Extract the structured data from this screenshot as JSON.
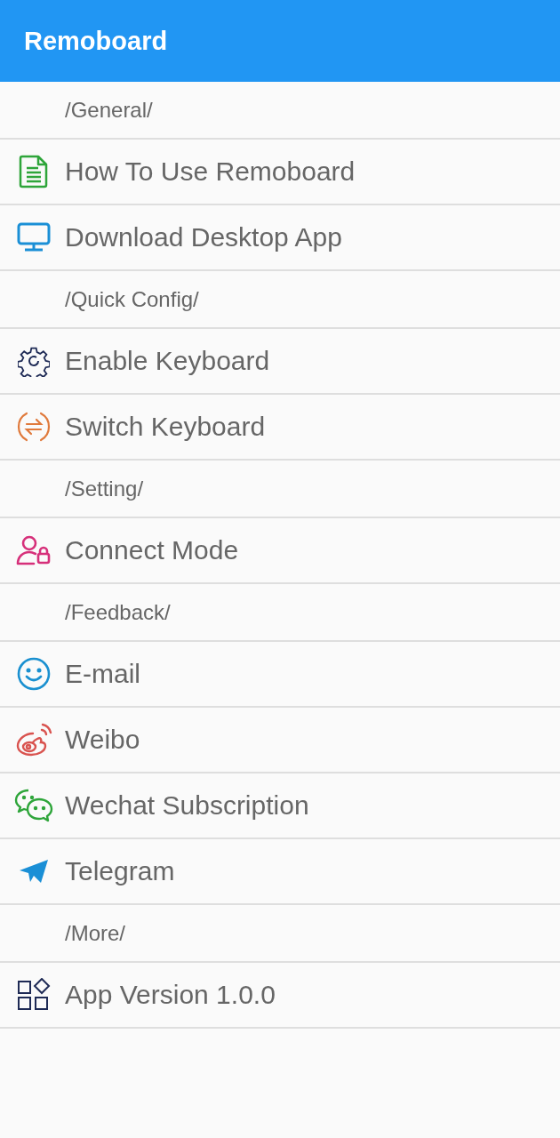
{
  "app_bar": {
    "title": "Remoboard"
  },
  "list": [
    {
      "kind": "section",
      "label": "/General/"
    },
    {
      "kind": "item",
      "label": "How To Use Remoboard"
    },
    {
      "kind": "item",
      "label": "Download Desktop App"
    },
    {
      "kind": "section",
      "label": "/Quick Config/"
    },
    {
      "kind": "item",
      "label": "Enable Keyboard"
    },
    {
      "kind": "item",
      "label": "Switch Keyboard"
    },
    {
      "kind": "section",
      "label": "/Setting/"
    },
    {
      "kind": "item",
      "label": "Connect Mode"
    },
    {
      "kind": "section",
      "label": "/Feedback/"
    },
    {
      "kind": "item",
      "label": "E-mail"
    },
    {
      "kind": "item",
      "label": "Weibo"
    },
    {
      "kind": "item",
      "label": "Wechat Subscription"
    },
    {
      "kind": "item",
      "label": "Telegram"
    },
    {
      "kind": "section",
      "label": "/More/"
    },
    {
      "kind": "item",
      "label": "App Version 1.0.0"
    }
  ]
}
